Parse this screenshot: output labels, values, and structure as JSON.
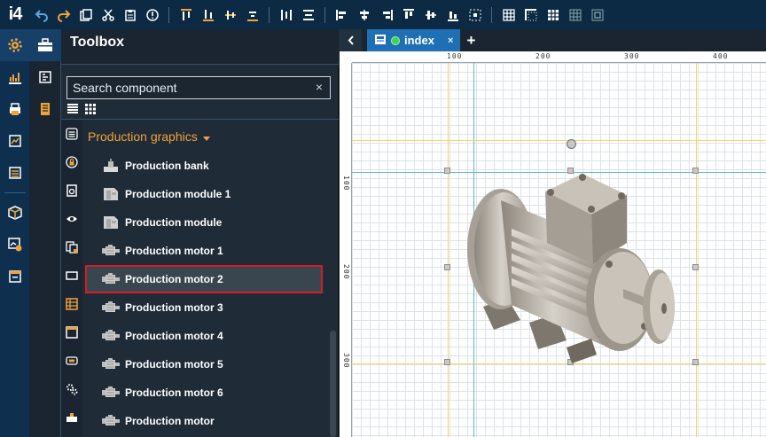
{
  "app": {
    "logo": "i4"
  },
  "toolbar": {
    "groups": [
      [
        "undo-icon",
        "redo-icon",
        "copy-icon",
        "cut-icon",
        "paste-icon",
        "info-icon"
      ],
      [
        "align-top-icon",
        "align-bottom-icon",
        "align-middle-icon",
        "align-baseline-icon"
      ],
      [
        "distribute-horizontal-icon",
        "distribute-vertical-icon"
      ],
      [
        "align-left-icon",
        "align-center-icon",
        "align-right-icon",
        "align-top-edge-icon",
        "align-middle-edge-icon",
        "align-bottom-edge-icon",
        "center-page-icon"
      ],
      [
        "grid-icon",
        "snap-corner-icon",
        "grid-lines-icon",
        "grid-dots-icon",
        "snap-icon"
      ]
    ]
  },
  "rail": {
    "items": [
      "settings-icon",
      "dashboard-icon",
      "print-icon",
      "report-icon",
      "list-icon",
      "package-icon",
      "chart-settings-icon",
      "window-icon"
    ]
  },
  "toolbox": {
    "title": "Toolbox",
    "search_placeholder": "Search component",
    "clear_label": "×",
    "group_title": "Production graphics",
    "items": [
      {
        "label": "Production bank",
        "icon": "production-bank-icon"
      },
      {
        "label": "Production module 1",
        "icon": "production-module-icon"
      },
      {
        "label": "Production module",
        "icon": "production-module-icon"
      },
      {
        "label": "Production motor 1",
        "icon": "production-motor-icon"
      },
      {
        "label": "Production motor 2",
        "icon": "production-motor-icon",
        "selected": true
      },
      {
        "label": "Production motor 3",
        "icon": "production-motor-icon"
      },
      {
        "label": "Production motor 4",
        "icon": "production-motor-icon"
      },
      {
        "label": "Production motor 5",
        "icon": "production-motor-icon"
      },
      {
        "label": "Production motor 6",
        "icon": "production-motor-icon"
      },
      {
        "label": "Production motor",
        "icon": "production-motor-icon"
      }
    ]
  },
  "tabs": {
    "back_label": "‹",
    "document": "index",
    "close_label": "×",
    "add_label": "+"
  },
  "rulers": {
    "top": [
      "100",
      "200",
      "300",
      "400"
    ],
    "left": [
      "100",
      "200",
      "300",
      "400"
    ]
  },
  "colors": {
    "accent": "#1f6fb5",
    "group_title": "#f0a23b",
    "selection": "#d41e22",
    "guide_yellow": "#f2d36b",
    "guide_cyan": "#59b8cf"
  }
}
